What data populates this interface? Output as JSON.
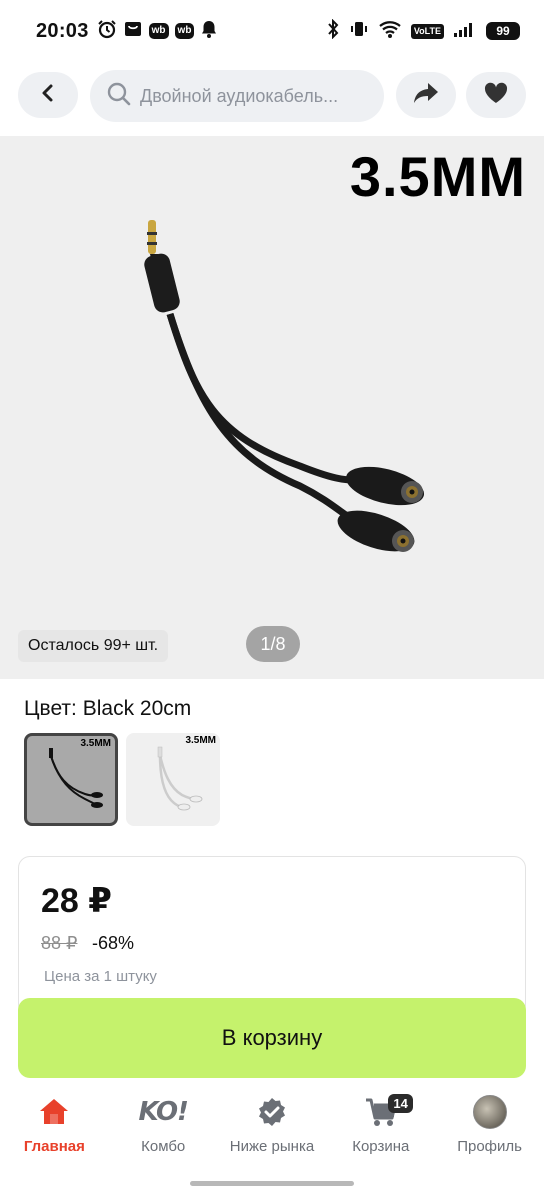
{
  "status_bar": {
    "time": "20:03",
    "wb_badge_1": "wb",
    "wb_badge_2": "wb",
    "volte": "VoLTE",
    "battery": "99"
  },
  "header": {
    "search_placeholder": "Двойной аудиокабель..."
  },
  "gallery": {
    "image_label": "3.5MM",
    "stock_text": "Осталось 99+ шт.",
    "counter": "1/8"
  },
  "color": {
    "label": "Цвет: Black 20cm",
    "swatches": [
      {
        "label": "3.5MM",
        "color": "black"
      },
      {
        "label": "3.5MM",
        "color": "white"
      }
    ]
  },
  "price": {
    "current": "28 ₽",
    "old": "88 ₽",
    "discount": "-68%",
    "unit_note": "Цена за 1 штуку"
  },
  "cart_button": {
    "label": "В корзину",
    "color": "#c5f26c"
  },
  "nav": {
    "items": [
      {
        "label": "Главная",
        "icon": "home-icon",
        "active": true
      },
      {
        "label": "Комбо",
        "icon": "ko-logo-icon"
      },
      {
        "label": "Ниже рынка",
        "icon": "verified-badge-icon"
      },
      {
        "label": "Корзина",
        "icon": "cart-icon",
        "badge": "14"
      },
      {
        "label": "Профиль",
        "icon": "avatar"
      }
    ],
    "active_color": "#e8412b"
  },
  "ko_logo_text": "KO!"
}
